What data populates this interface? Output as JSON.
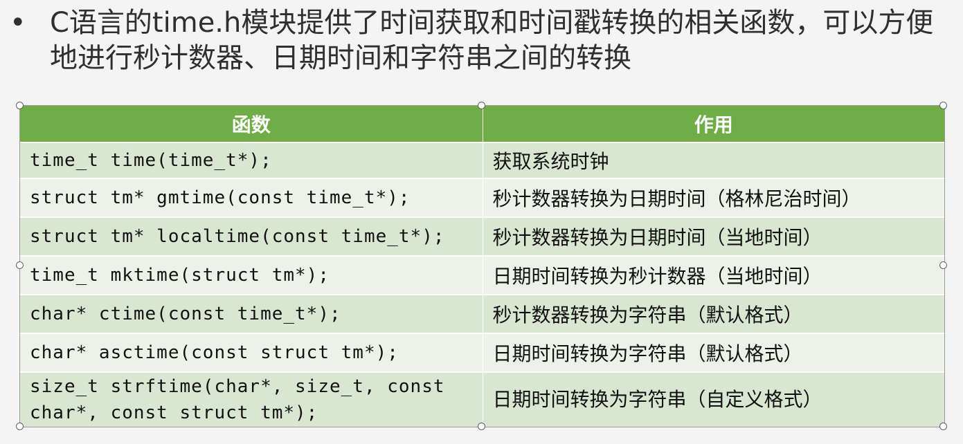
{
  "bullet": {
    "symbol": "•",
    "text": "C语言的time.h模块提供了时间获取和时间戳转换的相关函数，可以方便地进行秒计数器、日期时间和字符串之间的转换"
  },
  "table": {
    "headers": [
      "函数",
      "作用"
    ],
    "rows": [
      {
        "func": "time_t time(time_t*);",
        "desc": "获取系统时钟"
      },
      {
        "func": "struct tm* gmtime(const time_t*);",
        "desc": "秒计数器转换为日期时间（格林尼治时间）"
      },
      {
        "func": "struct tm* localtime(const time_t*);",
        "desc": "秒计数器转换为日期时间（当地时间）"
      },
      {
        "func": "time_t mktime(struct tm*);",
        "desc": "日期时间转换为秒计数器（当地时间）"
      },
      {
        "func": "char* ctime(const time_t*);",
        "desc": "秒计数器转换为字符串（默认格式）"
      },
      {
        "func": "char* asctime(const struct tm*);",
        "desc": "日期时间转换为字符串（默认格式）"
      },
      {
        "func": "size_t strftime(char*, size_t, const char*, const struct tm*);",
        "desc": "日期时间转换为字符串（自定义格式）"
      }
    ]
  },
  "colors": {
    "header_bg": "#70ad47",
    "row_odd": "#d9e6d1",
    "row_even": "#edf2e9"
  }
}
